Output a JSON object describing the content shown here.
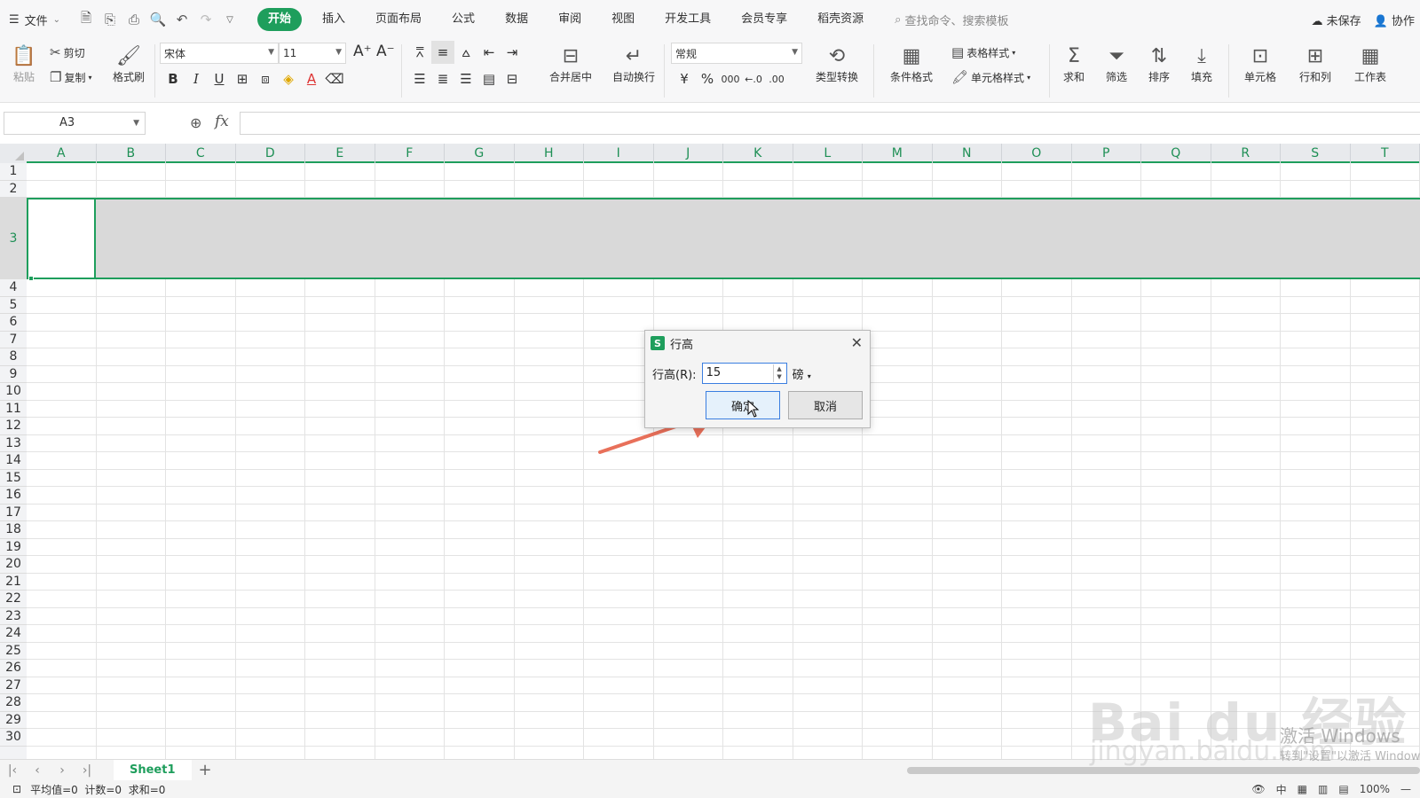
{
  "menubar": {
    "file_label": "文件",
    "tabs": [
      {
        "label": "开始",
        "active": true
      },
      {
        "label": "插入"
      },
      {
        "label": "页面布局"
      },
      {
        "label": "公式"
      },
      {
        "label": "数据"
      },
      {
        "label": "审阅"
      },
      {
        "label": "视图"
      },
      {
        "label": "开发工具"
      },
      {
        "label": "会员专享"
      },
      {
        "label": "稻壳资源"
      }
    ],
    "search_placeholder": "查找命令、搜索模板",
    "unsaved_label": "未保存",
    "collab_label": "协作"
  },
  "ribbon": {
    "paste": "粘贴",
    "cut": "剪切",
    "copy": "复制",
    "format_painter": "格式刷",
    "font_name": "宋体",
    "font_size": "11",
    "merge_center": "合并居中",
    "wrap_text": "自动换行",
    "number_format": "常规",
    "type_convert": "类型转换",
    "conditional_format": "条件格式",
    "table_style": "表格样式",
    "cell_style": "单元格样式",
    "sum": "求和",
    "filter": "筛选",
    "sort": "排序",
    "fill": "填充",
    "cell": "单元格",
    "row_col": "行和列",
    "worksheet": "工作表",
    "bold": "B",
    "italic": "I",
    "underline": "U",
    "currency": "¥",
    "percent": "%",
    "thousands": "000"
  },
  "formula_bar": {
    "name_box": "A3",
    "fx": "fx",
    "content": ""
  },
  "grid": {
    "columns": [
      "A",
      "B",
      "C",
      "D",
      "E",
      "F",
      "G",
      "H",
      "I",
      "J",
      "K",
      "L",
      "M",
      "N",
      "O",
      "P",
      "Q",
      "R",
      "S",
      "T"
    ],
    "rows": [
      "1",
      "2",
      "3",
      "4",
      "5",
      "6",
      "7",
      "8",
      "9",
      "10",
      "11",
      "12",
      "13",
      "14",
      "15",
      "16",
      "17",
      "18",
      "19",
      "20",
      "21",
      "22",
      "23",
      "24",
      "25",
      "26",
      "27",
      "28",
      "29",
      "30"
    ],
    "selected_row": "3",
    "active_cell": "A3"
  },
  "dialog": {
    "title": "行高",
    "field_label": "行高(R):",
    "value": "15",
    "unit": "磅",
    "ok": "确定",
    "cancel": "取消"
  },
  "sheets": {
    "active": "Sheet1",
    "add": "+"
  },
  "status": {
    "summary": "平均值=0  计数=0  求和=0",
    "zoom": "100%"
  },
  "watermark": {
    "brand": "Bai du 经验",
    "url": "jingyan.baidu.com",
    "activate_title": "激活 Windows",
    "activate_sub": "转到\"设置\"以激活 Windows。"
  },
  "colors": {
    "accent": "#1e9e5c",
    "selection_fill": "#d9d9d9",
    "annotation_arrow": "#e8705a"
  }
}
